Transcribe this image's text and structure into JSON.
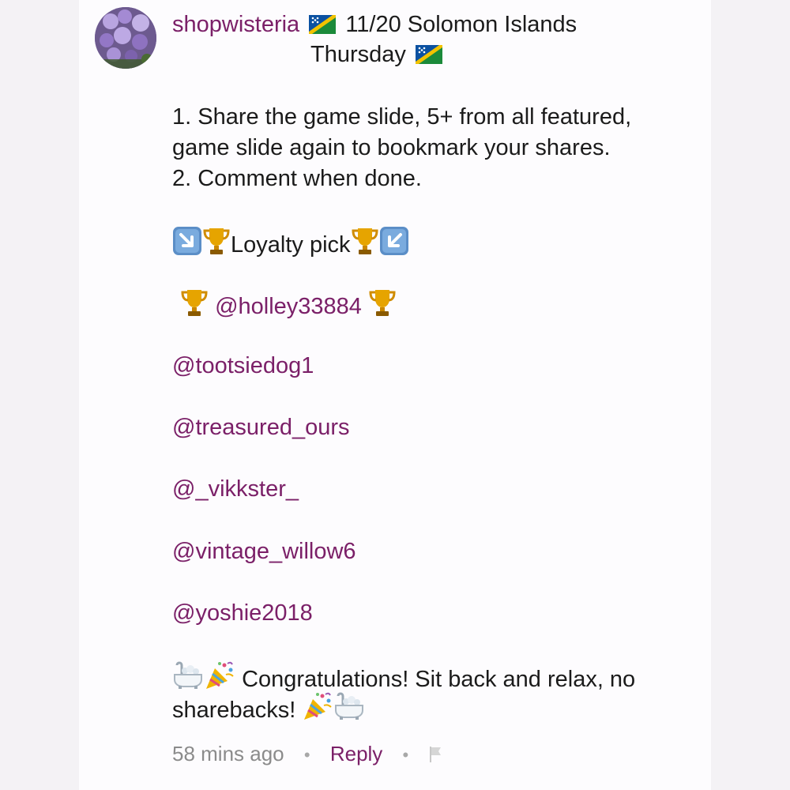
{
  "comment": {
    "username": "shopwisteria",
    "header_title": "11/20 Solomon Islands",
    "header_day": "Thursday",
    "instructions": [
      "1. Share the game slide, 5+ from all featured,",
      "game slide again to bookmark your shares.",
      "2. Comment when done."
    ],
    "loyalty_label": "Loyalty pick",
    "loyalty_pick": "@holley33884",
    "mentions": [
      "@tootsiedog1",
      "@treasured_ours",
      "@_vikkster_",
      "@vintage_willow6",
      "@yoshie2018"
    ],
    "congrats_line1": "Congratulations! Sit back and relax, no",
    "congrats_line2": "sharebacks!",
    "time_ago": "58 mins ago",
    "reply_label": "Reply",
    "dot": "•"
  },
  "icons": {
    "avatar": "wisteria-flowers-image",
    "flag": "solomon-islands-flag-icon",
    "trophy": "trophy-icon",
    "arrow_down_right": "arrow-down-right-icon",
    "arrow_down_left": "arrow-down-left-icon",
    "bathtub": "bathtub-icon",
    "party": "party-popper-icon",
    "report": "flag-report-icon"
  },
  "colors": {
    "accent": "#7b2068",
    "text": "#1b1b1b",
    "muted": "#8b8b8b"
  }
}
